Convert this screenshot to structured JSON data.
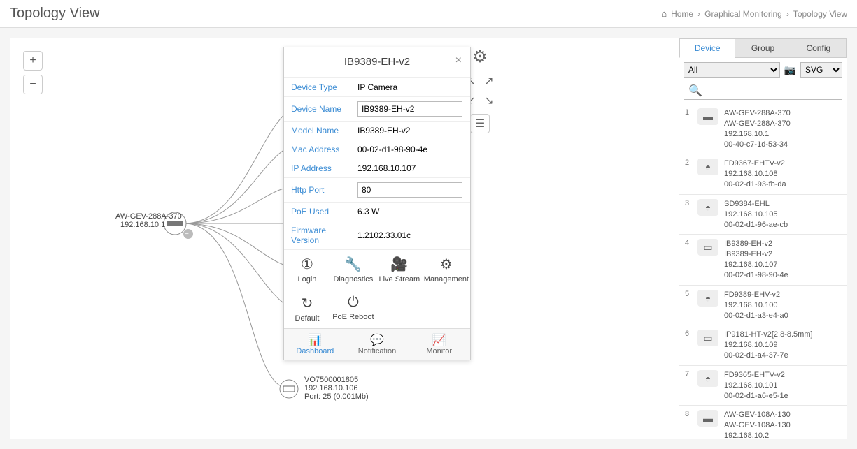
{
  "header": {
    "title": "Topology View"
  },
  "breadcrumb": {
    "home": "Home",
    "l1": "Graphical Monitoring",
    "l2": "Topology View"
  },
  "zoom": {
    "in": "+",
    "out": "−"
  },
  "rootNode": {
    "name": "AW-GEV-288A-370",
    "ip": "192.168.10.1"
  },
  "extraNode": {
    "mac": "VO7500001805",
    "ip": "192.168.10.106",
    "port": "Port: 25 (0.001Mb)"
  },
  "panel": {
    "title": "IB9389-EH-v2",
    "rows": {
      "deviceType": {
        "label": "Device Type",
        "value": "IP Camera"
      },
      "deviceName": {
        "label": "Device Name",
        "value": "IB9389-EH-v2"
      },
      "modelName": {
        "label": "Model Name",
        "value": "IB9389-EH-v2"
      },
      "mac": {
        "label": "Mac Address",
        "value": "00-02-d1-98-90-4e"
      },
      "ip": {
        "label": "IP Address",
        "value": "192.168.10.107"
      },
      "http": {
        "label": "Http Port",
        "value": "80"
      },
      "poe": {
        "label": "PoE Used",
        "value": "6.3 W"
      },
      "fw": {
        "label": "Firmware Version",
        "value": "1.2102.33.01c"
      }
    },
    "actions": {
      "login": "Login",
      "diag": "Diagnostics",
      "live": "Live Stream",
      "mgmt": "Management",
      "default": "Default",
      "reboot": "PoE Reboot"
    },
    "bottomTabs": {
      "dash": "Dashboard",
      "notif": "Notification",
      "mon": "Monitor"
    }
  },
  "sidebar": {
    "tabs": {
      "device": "Device",
      "group": "Group",
      "config": "Config"
    },
    "filter": "All",
    "format": "SVG",
    "devices": [
      {
        "n": "1",
        "l1": "AW-GEV-288A-370",
        "l2": "AW-GEV-288A-370",
        "l3": "192.168.10.1",
        "l4": "00-40-c7-1d-53-34",
        "icon": "▬"
      },
      {
        "n": "2",
        "l1": "FD9367-EHTV-v2",
        "l2": "",
        "l3": "192.168.10.108",
        "l4": "00-02-d1-93-fb-da",
        "icon": "◓"
      },
      {
        "n": "3",
        "l1": "SD9384-EHL",
        "l2": "",
        "l3": "192.168.10.105",
        "l4": "00-02-d1-96-ae-cb",
        "icon": "◓"
      },
      {
        "n": "4",
        "l1": "IB9389-EH-v2",
        "l2": "IB9389-EH-v2",
        "l3": "192.168.10.107",
        "l4": "00-02-d1-98-90-4e",
        "icon": "▭"
      },
      {
        "n": "5",
        "l1": "FD9389-EHV-v2",
        "l2": "",
        "l3": "192.168.10.100",
        "l4": "00-02-d1-a3-e4-a0",
        "icon": "◓"
      },
      {
        "n": "6",
        "l1": "IP9181-HT-v2[2.8-8.5mm]",
        "l2": "",
        "l3": "192.168.10.109",
        "l4": "00-02-d1-a4-37-7e",
        "icon": "▭"
      },
      {
        "n": "7",
        "l1": "FD9365-EHTV-v2",
        "l2": "",
        "l3": "192.168.10.101",
        "l4": "00-02-d1-a6-e5-1e",
        "icon": "◓"
      },
      {
        "n": "8",
        "l1": "AW-GEV-108A-130",
        "l2": "AW-GEV-108A-130",
        "l3": "192.168.10.2",
        "l4": "",
        "icon": "▬"
      }
    ]
  }
}
